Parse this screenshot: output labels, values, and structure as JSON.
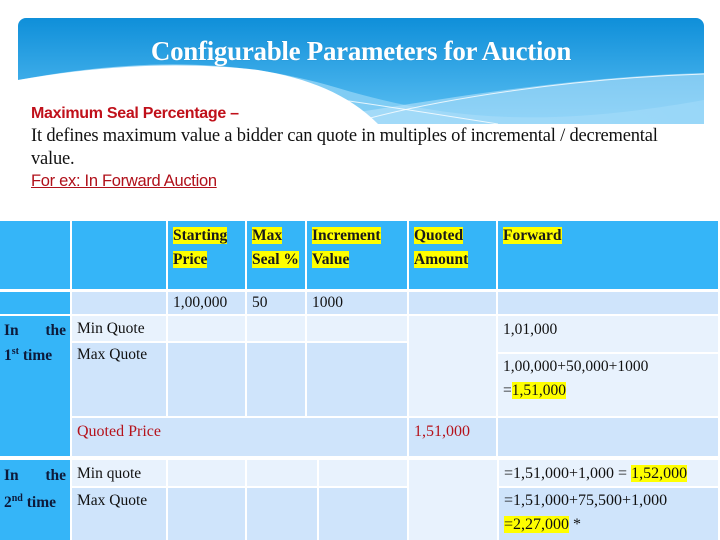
{
  "banner": {
    "title": "Configurable Parameters for Auction"
  },
  "description": {
    "heading": "Maximum Seal Percentage –",
    "body": "It defines maximum value a bidder can quote in multiples of incremental / decremental value.",
    "example_link": "For ex: In Forward Auction"
  },
  "table": {
    "headers": {
      "starting_price": [
        "Starting",
        "Price"
      ],
      "max_seal": [
        "Max",
        "Seal %"
      ],
      "increment_value": [
        "Increment",
        "Value"
      ],
      "quoted_amount": [
        "Quoted",
        "Amount"
      ],
      "forward": "Forward"
    },
    "values_row": {
      "starting_price": "1,00,000",
      "max_seal": "50",
      "increment_value": "1000"
    },
    "first_time": {
      "label_a": "In",
      "label_b": "the",
      "ordinal": "1",
      "ordinal_suffix": "st",
      "label_c": "time",
      "min_label": "Min Quote",
      "max_label": "Max Quote",
      "min_value": "1,01,000",
      "max_formula": "1,00,000+50,000+1000",
      "max_result_prefix": "=",
      "max_result": "1,51,000",
      "quoted_price_label": "Quoted Price",
      "quoted_price_value": "1,51,000"
    },
    "second_time": {
      "label_a": "In",
      "label_b": "the",
      "ordinal": "2",
      "ordinal_suffix": "nd",
      "label_c": "time",
      "min_label": "Min quote",
      "max_label": "Max Quote",
      "min_formula": "=1,51,000+1,000 = ",
      "min_result": "1,52,000",
      "max_formula": "=1,51,000+75,500+1,000",
      "max_result": "=2,27,000",
      "max_note": " *"
    }
  },
  "colors": {
    "header_blue": "#35b5f8",
    "cell_light": "#cfe4fb",
    "cell_lighter": "#e8f2fd",
    "highlight": "#ffff00",
    "accent_red": "#c0101a"
  }
}
